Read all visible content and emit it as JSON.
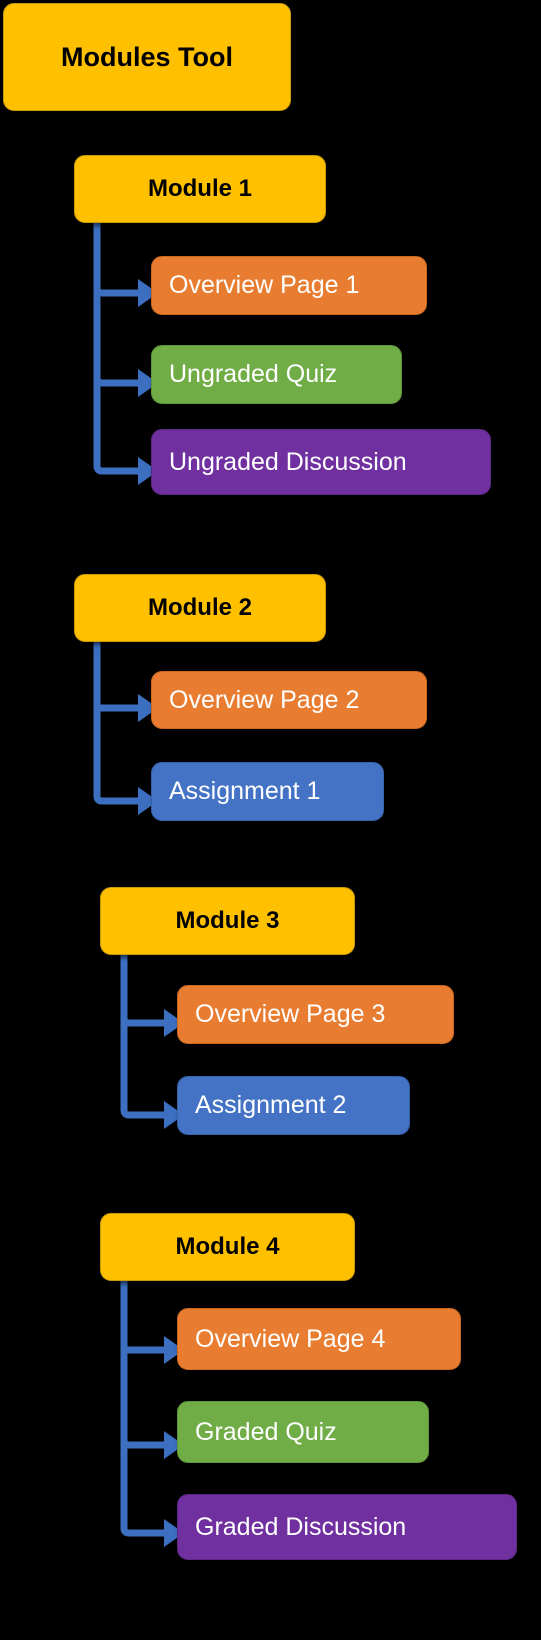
{
  "diagram": {
    "title": "Modules Tool",
    "background_color": "#000000",
    "arrow_color": "#3C6FC0",
    "root": {
      "label": "Modules Tool",
      "color": "#FFC000"
    },
    "node_colors": {
      "module": "#FFC000",
      "page": "#E87D31",
      "quiz": "#70AD47",
      "discussion": "#7030A0",
      "assignment": "#4472C4"
    },
    "modules": [
      {
        "label": "Module 1",
        "children": [
          {
            "label": "Overview Page 1",
            "type": "page"
          },
          {
            "label": "Ungraded Quiz",
            "type": "quiz"
          },
          {
            "label": "Ungraded Discussion",
            "type": "discussion"
          }
        ]
      },
      {
        "label": "Module 2",
        "children": [
          {
            "label": "Overview Page 2",
            "type": "page"
          },
          {
            "label": "Assignment 1",
            "type": "assignment"
          }
        ]
      },
      {
        "label": "Module 3",
        "children": [
          {
            "label": "Overview Page 3",
            "type": "page"
          },
          {
            "label": "Assignment 2",
            "type": "assignment"
          }
        ]
      },
      {
        "label": "Module 4",
        "children": [
          {
            "label": "Overview Page 4",
            "type": "page"
          },
          {
            "label": "Graded Quiz",
            "type": "quiz"
          },
          {
            "label": "Graded Discussion",
            "type": "discussion"
          }
        ]
      }
    ]
  }
}
